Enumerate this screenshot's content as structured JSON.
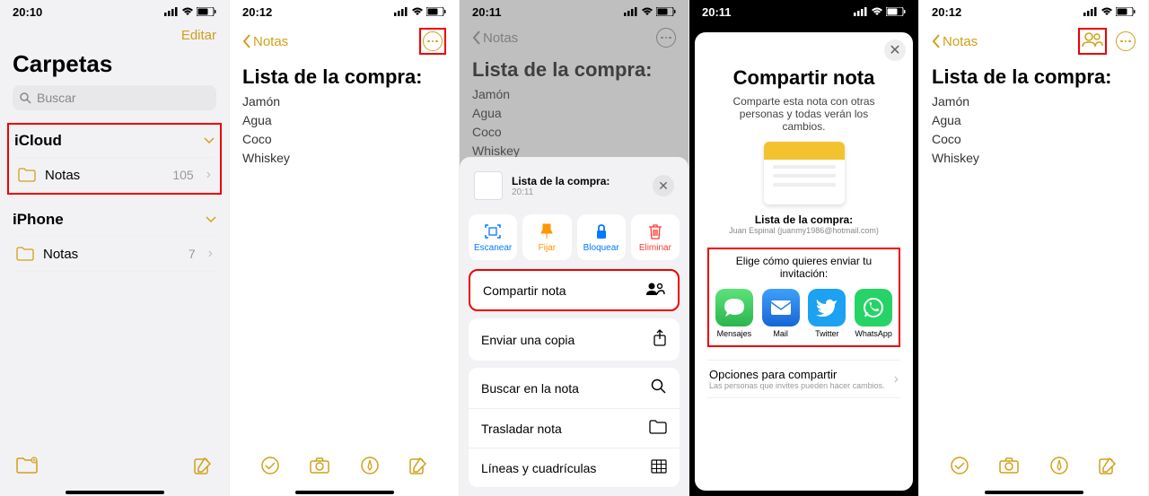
{
  "screen1": {
    "status_time": "20:10",
    "edit": "Editar",
    "title": "Carpetas",
    "search_placeholder": "Buscar",
    "section_icloud": "iCloud",
    "section_iphone": "iPhone",
    "folder_notes": "Notas",
    "count_icloud": "105",
    "count_iphone": "7"
  },
  "screen2": {
    "status_time": "20:12",
    "back": "Notas",
    "title": "Lista de la compra:",
    "items": [
      "Jamón",
      "Agua",
      "Coco",
      "Whiskey"
    ]
  },
  "screen3": {
    "status_time": "20:11",
    "back": "Notas",
    "title": "Lista de la compra:",
    "items": [
      "Jamón",
      "Agua",
      "Coco",
      "Whiskey"
    ],
    "sheet_title": "Lista de la compra:",
    "sheet_time": "20:11",
    "action_scan": "Escanear",
    "action_pin": "Fijar",
    "action_lock": "Bloquear",
    "action_delete": "Eliminar",
    "menu_share": "Compartir nota",
    "menu_copy": "Enviar una copia",
    "menu_find": "Buscar en la nota",
    "menu_move": "Trasladar nota",
    "menu_lines": "Líneas y cuadrículas"
  },
  "screen4": {
    "status_time": "20:11",
    "modal_title": "Compartir nota",
    "modal_desc": "Comparte esta nota con otras personas y todas verán los cambios.",
    "note_title": "Lista de la compra:",
    "note_owner": "Juan Espinal (juanmy1986@hotmail.com)",
    "invite_label": "Elige cómo quieres enviar tu invitación:",
    "app_messages": "Mensajes",
    "app_mail": "Mail",
    "app_twitter": "Twitter",
    "app_whatsapp": "WhatsApp",
    "opt_title": "Opciones para compartir",
    "opt_sub": "Las personas que invites pueden hacer cambios."
  },
  "screen5": {
    "status_time": "20:12",
    "back": "Notas",
    "title": "Lista de la compra:",
    "items": [
      "Jamón",
      "Agua",
      "Coco",
      "Whiskey"
    ]
  }
}
